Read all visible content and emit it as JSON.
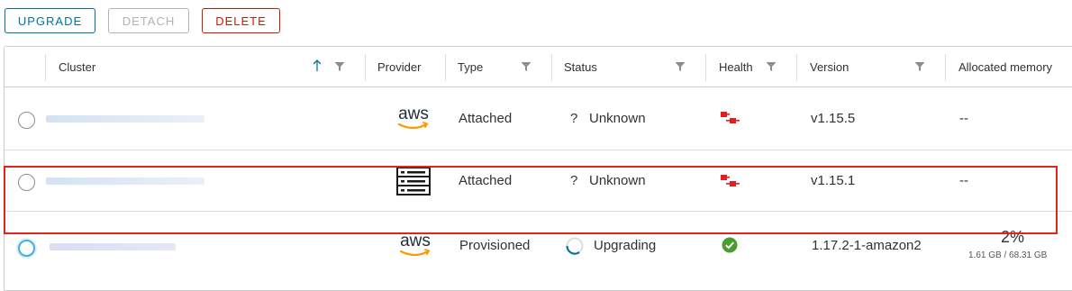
{
  "toolbar": {
    "upgrade_label": "UPGRADE",
    "detach_label": "DETACH",
    "delete_label": "DELETE"
  },
  "columns": {
    "cluster": "Cluster",
    "provider": "Provider",
    "type": "Type",
    "status": "Status",
    "health": "Health",
    "version": "Version",
    "allocated_memory": "Allocated memory"
  },
  "rows": [
    {
      "provider_icon": "aws-logo",
      "type": "Attached",
      "status_icon": "question-mark-icon",
      "status_symbol": "?",
      "status": "Unknown",
      "health_icon": "disconnected-plug-icon",
      "version": "v1.15.5",
      "memory": "--"
    },
    {
      "provider_icon": "server-rack-icon",
      "type": "Attached",
      "status_icon": "question-mark-icon",
      "status_symbol": "?",
      "status": "Unknown",
      "health_icon": "disconnected-plug-icon",
      "version": "v1.15.1",
      "memory": "--"
    },
    {
      "provider_icon": "aws-logo",
      "type": "Provisioned",
      "status_icon": "spinner-icon",
      "status": "Upgrading",
      "health_icon": "check-circle-icon",
      "version": "1.17.2-1-amazon2",
      "memory_percent": "2%",
      "memory_detail": "1.61 GB / 68.31 GB"
    }
  ],
  "colors": {
    "primary": "#0072a3",
    "danger": "#c21d00",
    "healthy": "#4c9c2e",
    "selection_outline": "#e4241c",
    "aws_orange": "#ff9900"
  }
}
